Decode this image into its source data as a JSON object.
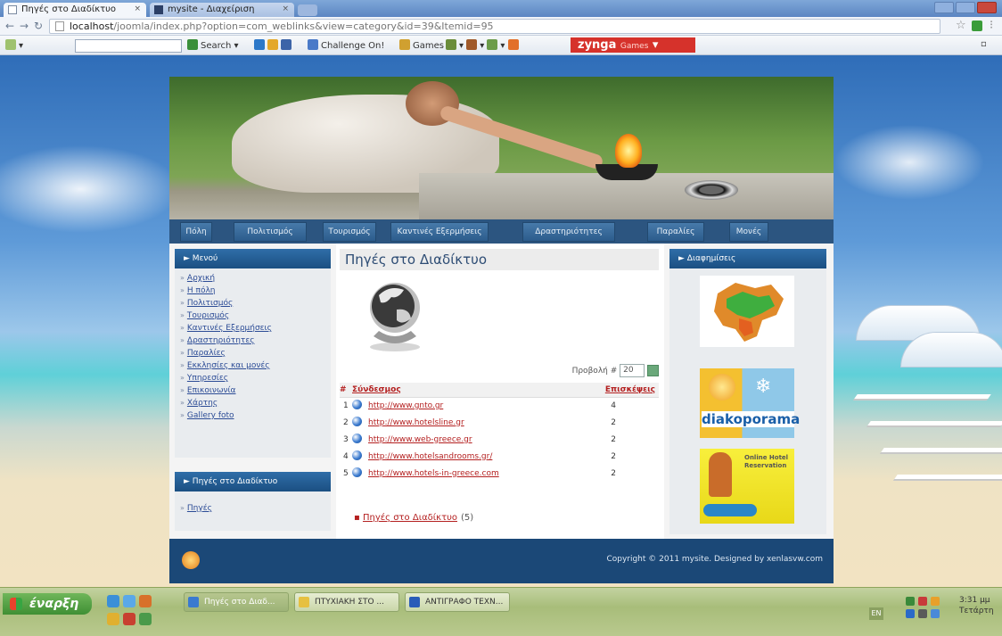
{
  "browser": {
    "tabs": [
      {
        "label": "Πηγές στο Διαδίκτυο",
        "close": "×"
      },
      {
        "label": "mysite - Διαχείριση",
        "close": "×"
      }
    ],
    "url_host": "localhost",
    "url_rest": "/joomla/index.php?option=com_weblinks&view=category&id=39&Itemid=95",
    "toolbar": {
      "search_label": "Search",
      "challenge_label": "Challenge On!",
      "games_label": "Games",
      "zynga_label": "zynga",
      "zynga_sub": "Games"
    }
  },
  "site": {
    "nav": [
      "Πόλη",
      "Πολιτισμός",
      "Τουρισμός",
      "Καντινές Εξερμήσεις",
      "Δραστηριότητες",
      "Παραλίες",
      "Μονές"
    ],
    "left_menu_title": "Μενού",
    "left_menu": [
      "Αρχική",
      "Η πόλη",
      "Πολιτισμός",
      "Τουρισμός",
      "Καντινές Εξερμήσεις",
      "Δραστηριότητες",
      "Παραλίες",
      "Εκκλησίες και μονές",
      "Υπηρεσίες",
      "Επικοινωνία",
      "Χάρτης",
      "Gallery foto"
    ],
    "left_module2_title": "Πηγές στο Διαδίκτυο",
    "left_module2_items": [
      "Πηγές"
    ],
    "page_title": "Πηγές στο Διαδίκτυο",
    "display_label": "Προβολή #",
    "display_value": "20",
    "table_headers": {
      "num": "#",
      "link": "Σύνδεσμος",
      "hits": "Επισκέψεις"
    },
    "links": [
      {
        "num": "1",
        "url": "http://www.gnto.gr",
        "hits": "4"
      },
      {
        "num": "2",
        "url": "http://www.hotelsline.gr",
        "hits": "2"
      },
      {
        "num": "3",
        "url": "http://www.web-greece.gr",
        "hits": "2"
      },
      {
        "num": "4",
        "url": "http://www.hotelsandrooms.gr/",
        "hits": "2"
      },
      {
        "num": "5",
        "url": "http://www.hotels-in-greece.com",
        "hits": "2"
      }
    ],
    "category_link": "Πηγές στο Διαδίκτυο",
    "category_count": "(5)",
    "right_title": "Διαφημίσεις",
    "ads": [
      "diakoporama",
      "Online Hotel Reservation"
    ],
    "copyright": "Copyright © 2011 mysite. Designed by xenlasvw.com"
  },
  "taskbar": {
    "start": "έναρξη",
    "tasks": [
      "Πηγές στο Διαδ...",
      "ΠΤΥΧΙΑΚΗ ΣΤΟ ...",
      "ΑΝΤΙΓΡΑΦΟ ΤΕΧΝ..."
    ],
    "lang": "EN",
    "clock_time": "3:31 μμ",
    "clock_day": "Τετάρτη"
  }
}
